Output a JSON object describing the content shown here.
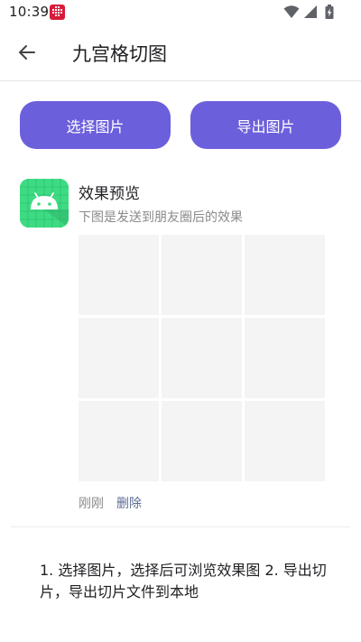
{
  "status_bar": {
    "time": "10:39",
    "icons": [
      "app-notification-icon",
      "wifi-icon",
      "signal-icon",
      "battery-icon"
    ]
  },
  "app_bar": {
    "back_icon": "arrow-left-icon",
    "title": "九宫格切图"
  },
  "actions": {
    "select_label": "选择图片",
    "export_label": "导出图片",
    "accent_color": "#6c5fdc"
  },
  "preview": {
    "avatar_icon": "android-robot-icon",
    "title": "效果预览",
    "subtitle": "下图是发送到朋友圈后的效果",
    "grid_rows": 3,
    "grid_cols": 3,
    "time": "刚刚",
    "delete_label": "删除"
  },
  "instructions": {
    "text": "1. 选择图片，选择后可浏览效果图 2. 导出切片，导出切片文件到本地"
  }
}
